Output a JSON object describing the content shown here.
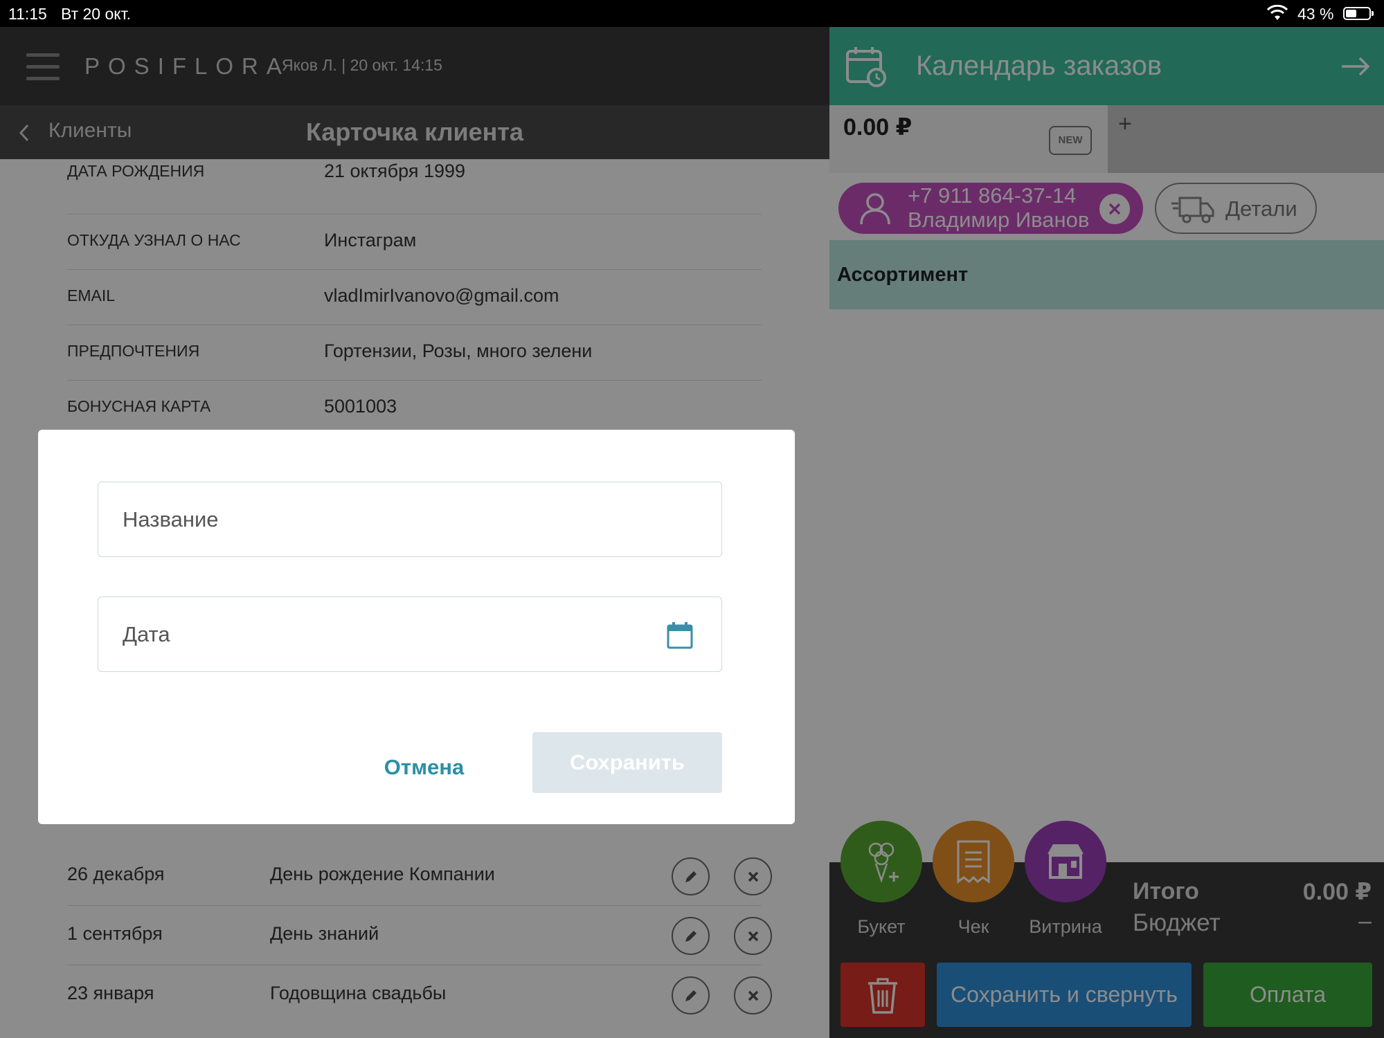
{
  "status_bar": {
    "time": "11:15",
    "date": "Вт 20 окт.",
    "battery": "43 %"
  },
  "header": {
    "logo": "POSIFLORA",
    "user": "Яков Л. | 20 окт. 14:15"
  },
  "nav": {
    "back_label": "Клиенты",
    "title": "Карточка клиента"
  },
  "client_fields": [
    {
      "label": "ДАТА РОЖДЕНИЯ",
      "value": "21 октября 1999"
    },
    {
      "label": "ОТКУДА УЗНАЛ О НАС",
      "value": "Инстаграм"
    },
    {
      "label": "EMAIL",
      "value": "vladImirIvanovo@gmail.com"
    },
    {
      "label": "ПРЕДПОЧТЕНИЯ",
      "value": "Гортензии, Розы, много зелени"
    },
    {
      "label": "БОНУСНАЯ КАРТА",
      "value": "5001003"
    }
  ],
  "events": [
    {
      "date": "26 декабря",
      "title": "День рождение Компании"
    },
    {
      "date": "1 сентября",
      "title": "День знаний"
    },
    {
      "date": "23 января",
      "title": "Годовщина свадьбы"
    }
  ],
  "dialog": {
    "name_placeholder": "Название",
    "date_placeholder": "Дата",
    "cancel_label": "Отмена",
    "save_label": "Сохранить"
  },
  "right_panel": {
    "title": "Календарь заказов",
    "order_tab": {
      "amount": "0.00 ₽",
      "badge": "NEW",
      "add": "+"
    },
    "client": {
      "phone": "+7 911 864-37-14",
      "name": "Владимир Иванов"
    },
    "details_label": "Детали",
    "assortment_title": "Ассортимент",
    "actions": [
      {
        "label": "Букет",
        "color": "#58a832",
        "icon": "bouquet-icon"
      },
      {
        "label": "Чек",
        "color": "#e8902a",
        "icon": "receipt-icon"
      },
      {
        "label": "Витрина",
        "color": "#9b3fb8",
        "icon": "storefront-icon"
      }
    ],
    "total_label": "Итого",
    "total_value": "0.00 ₽",
    "budget_label": "Бюджет",
    "budget_value": "–",
    "save_collapse_label": "Сохранить и свернуть",
    "pay_label": "Оплата"
  },
  "colors": {
    "accent": "#3fbf9f",
    "client_chip": "#c44fc0",
    "delete": "#d9342b",
    "save": "#2f8fd9",
    "pay": "#3aa83a",
    "dialog_link": "#2b8fa3"
  }
}
